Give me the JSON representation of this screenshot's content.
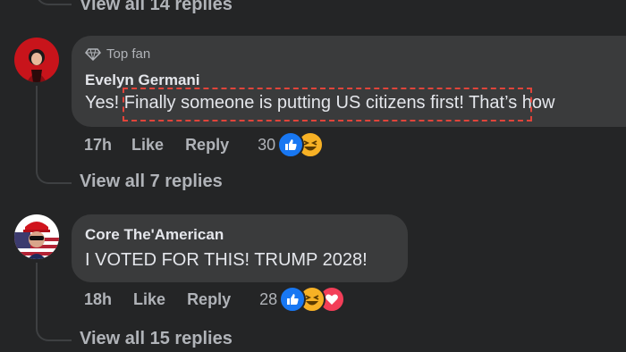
{
  "thread_top": {
    "view_replies": "View all 14 replies"
  },
  "comment1": {
    "badge": "Top fan",
    "author": "Evelyn Germani",
    "text_prefix": "Yes!",
    "text_highlight": " Finally someone is putting US citizens first!",
    "text_suffix": " That’s how",
    "time": "17h",
    "like": "Like",
    "reply": "Reply",
    "reaction_count": "30",
    "reactions": [
      "like-icon",
      "haha-icon"
    ],
    "view_replies": "View all 7 replies"
  },
  "comment2": {
    "author": "Core The'American",
    "text": "I VOTED FOR THIS! TRUMP 2028!",
    "time": "18h",
    "like": "Like",
    "reply": "Reply",
    "reaction_count": "28",
    "reactions": [
      "like-icon",
      "haha-icon",
      "love-icon"
    ],
    "view_replies": "View all 15 replies"
  },
  "colors": {
    "background": "#242526",
    "bubble": "#3a3b3c",
    "secondary_text": "#b0b3b8",
    "like_blue": "#1877f2",
    "love_red": "#f33e58",
    "haha_yellow": "#f7b125",
    "highlight_red": "#e0443a"
  }
}
